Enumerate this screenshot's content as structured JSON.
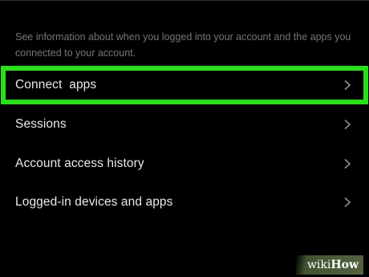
{
  "description": "See information about when you logged into your account and the apps you connected to your account.",
  "menu": [
    {
      "label": "Connect  apps",
      "icon": "chevron-right-icon",
      "highlighted": true
    },
    {
      "label": "Sessions",
      "icon": "chevron-right-icon"
    },
    {
      "label": "Account access history",
      "icon": "chevron-right-icon"
    },
    {
      "label": "Logged-in devices and apps",
      "icon": "chevron-right-icon"
    }
  ],
  "highlight_color": "#2bdf1c",
  "watermark": {
    "part1": "wiki",
    "part2": "How"
  }
}
